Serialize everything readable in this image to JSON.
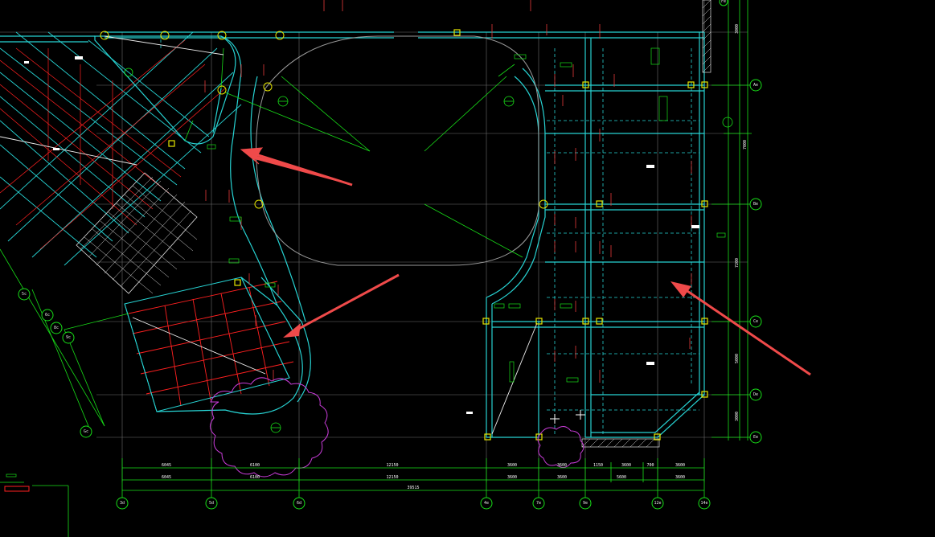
{
  "colors": {
    "background": "#000000",
    "wall": "#27d3d3",
    "grid": "#c8c8c8",
    "dimension": "#18e018",
    "rebar": "#ff2020",
    "annotation_red": "#e83a3a",
    "arrow": "#ef4a4a",
    "cloud": "#c83cd8",
    "column": "#e6e600",
    "text": "#ffffff"
  },
  "axis_bubbles_bottom": [
    {
      "id": "a-3d",
      "label": "3d"
    },
    {
      "id": "a-5d",
      "label": "5d"
    },
    {
      "id": "a-6d",
      "label": "6d"
    },
    {
      "id": "a-4e",
      "label": "4e"
    },
    {
      "id": "a-7e",
      "label": "7e"
    },
    {
      "id": "a-9e",
      "label": "9e"
    },
    {
      "id": "a-12e",
      "label": "12e"
    },
    {
      "id": "a-14e",
      "label": "14e"
    }
  ],
  "axis_bubbles_right": [
    {
      "id": "r-ae",
      "label": "Ae"
    },
    {
      "id": "r-be",
      "label": "Be"
    },
    {
      "id": "r-ce",
      "label": "Ce"
    },
    {
      "id": "r-de",
      "label": "De"
    },
    {
      "id": "r-ee",
      "label": "Ee"
    },
    {
      "id": "r-fe",
      "label": "Fe"
    }
  ],
  "axis_bubbles_left": [
    {
      "id": "l-5c",
      "label": "5c"
    },
    {
      "id": "l-6c",
      "label": "6c"
    },
    {
      "id": "l-8c",
      "label": "8c"
    },
    {
      "id": "l-9c",
      "label": "9c"
    },
    {
      "id": "l-gc",
      "label": "Gc"
    }
  ],
  "dimensions_bottom_row1": [
    "6045",
    "6100",
    "12150",
    "3600",
    "3600",
    "1150",
    "3600",
    "700",
    "3600"
  ],
  "dimensions_bottom_row2": [
    "6045",
    "6100",
    "12150",
    "3600",
    "3600",
    "5600",
    "3600"
  ],
  "dimension_total": "39515",
  "dimensions_right": [
    "3000",
    "7000",
    "7200",
    "5000",
    "3000"
  ]
}
